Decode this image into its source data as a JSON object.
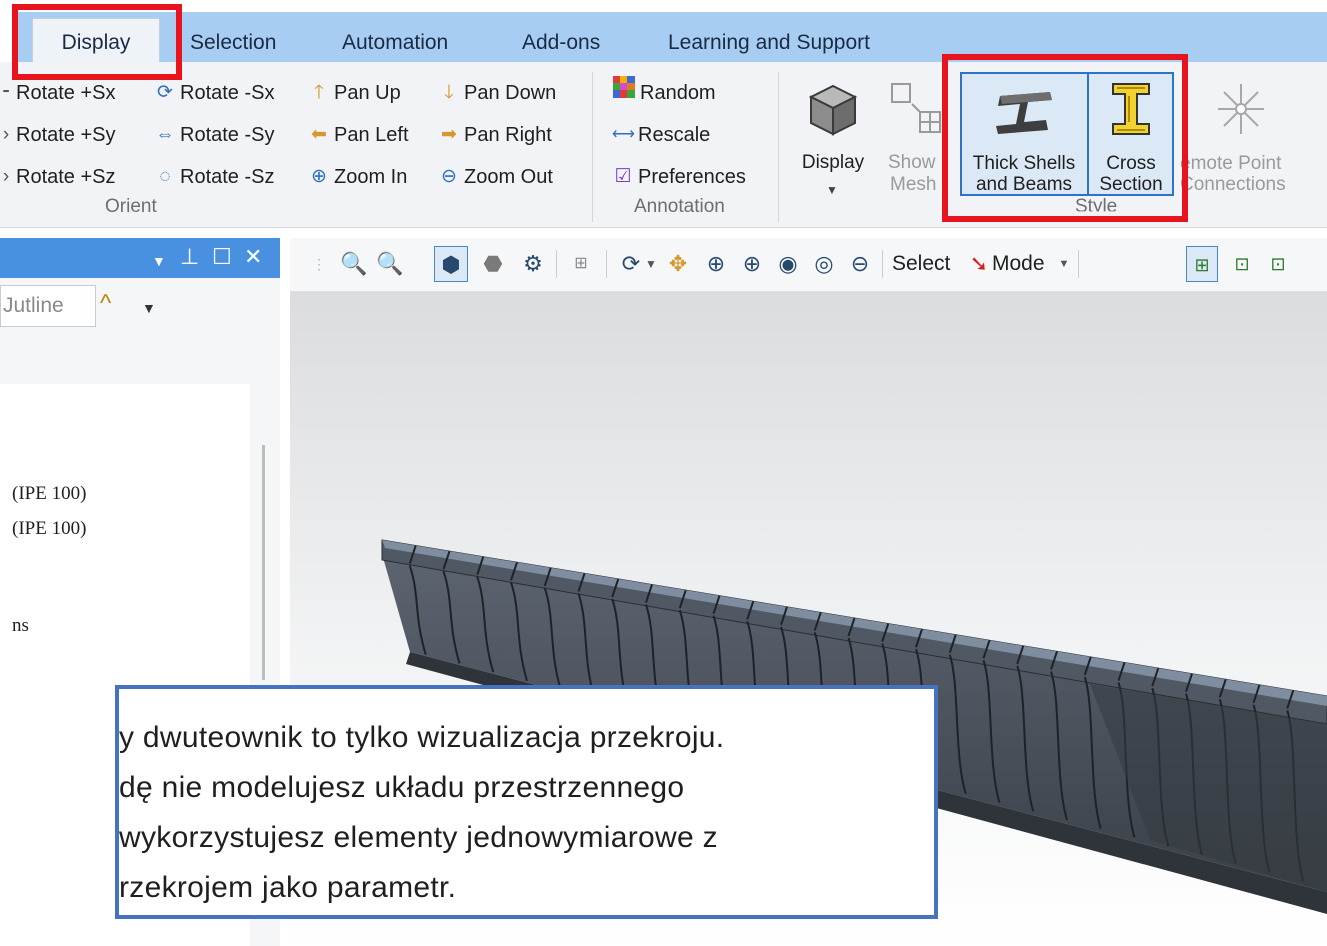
{
  "tabs": {
    "display": "Display",
    "selection": "Selection",
    "automation": "Automation",
    "addons": "Add-ons",
    "learning": "Learning and Support"
  },
  "orient": {
    "rotate_psx": "Rotate +Sx",
    "rotate_msx": "Rotate -Sx",
    "rotate_psy": "Rotate +Sy",
    "rotate_msy": "Rotate -Sy",
    "rotate_psz": "Rotate +Sz",
    "rotate_msz": "Rotate -Sz",
    "pan_up": "Pan Up",
    "pan_down": "Pan Down",
    "pan_left": "Pan Left",
    "pan_right": "Pan Right",
    "zoom_in": "Zoom In",
    "zoom_out": "Zoom Out",
    "group_label": "Orient"
  },
  "annotation": {
    "random": "Random",
    "rescale": "Rescale",
    "preferences": "Preferences",
    "group_label": "Annotation"
  },
  "style": {
    "display": "Display",
    "show_mesh_1": "Show",
    "show_mesh_2": "Mesh",
    "thick_1": "Thick Shells",
    "thick_2": "and Beams",
    "cross_1": "Cross",
    "cross_2": "Section",
    "remote_1": "emote Point",
    "remote_2": "Connections",
    "group_label": "Style"
  },
  "panel": {
    "outline_tab": "Jutline",
    "tree_items": [
      "(IPE 100)",
      "(IPE 100)",
      "ns"
    ]
  },
  "graphics_toolbar": {
    "select": "Select",
    "mode": "Mode"
  },
  "note": {
    "lines": [
      "y dwuteownik to tylko wizualizacja przekroju.",
      "dę nie modelujesz układu przestrzennego",
      " wykorzystujesz elementy jednowymiarowe z",
      "rzekrojem jako parametr."
    ]
  },
  "colors": {
    "tab_bar": "#a8cdf2",
    "highlight": "#e8141d",
    "selected_button_border": "#2c74c9",
    "panel_header": "#4a90e0",
    "note_border": "#4673c0"
  }
}
